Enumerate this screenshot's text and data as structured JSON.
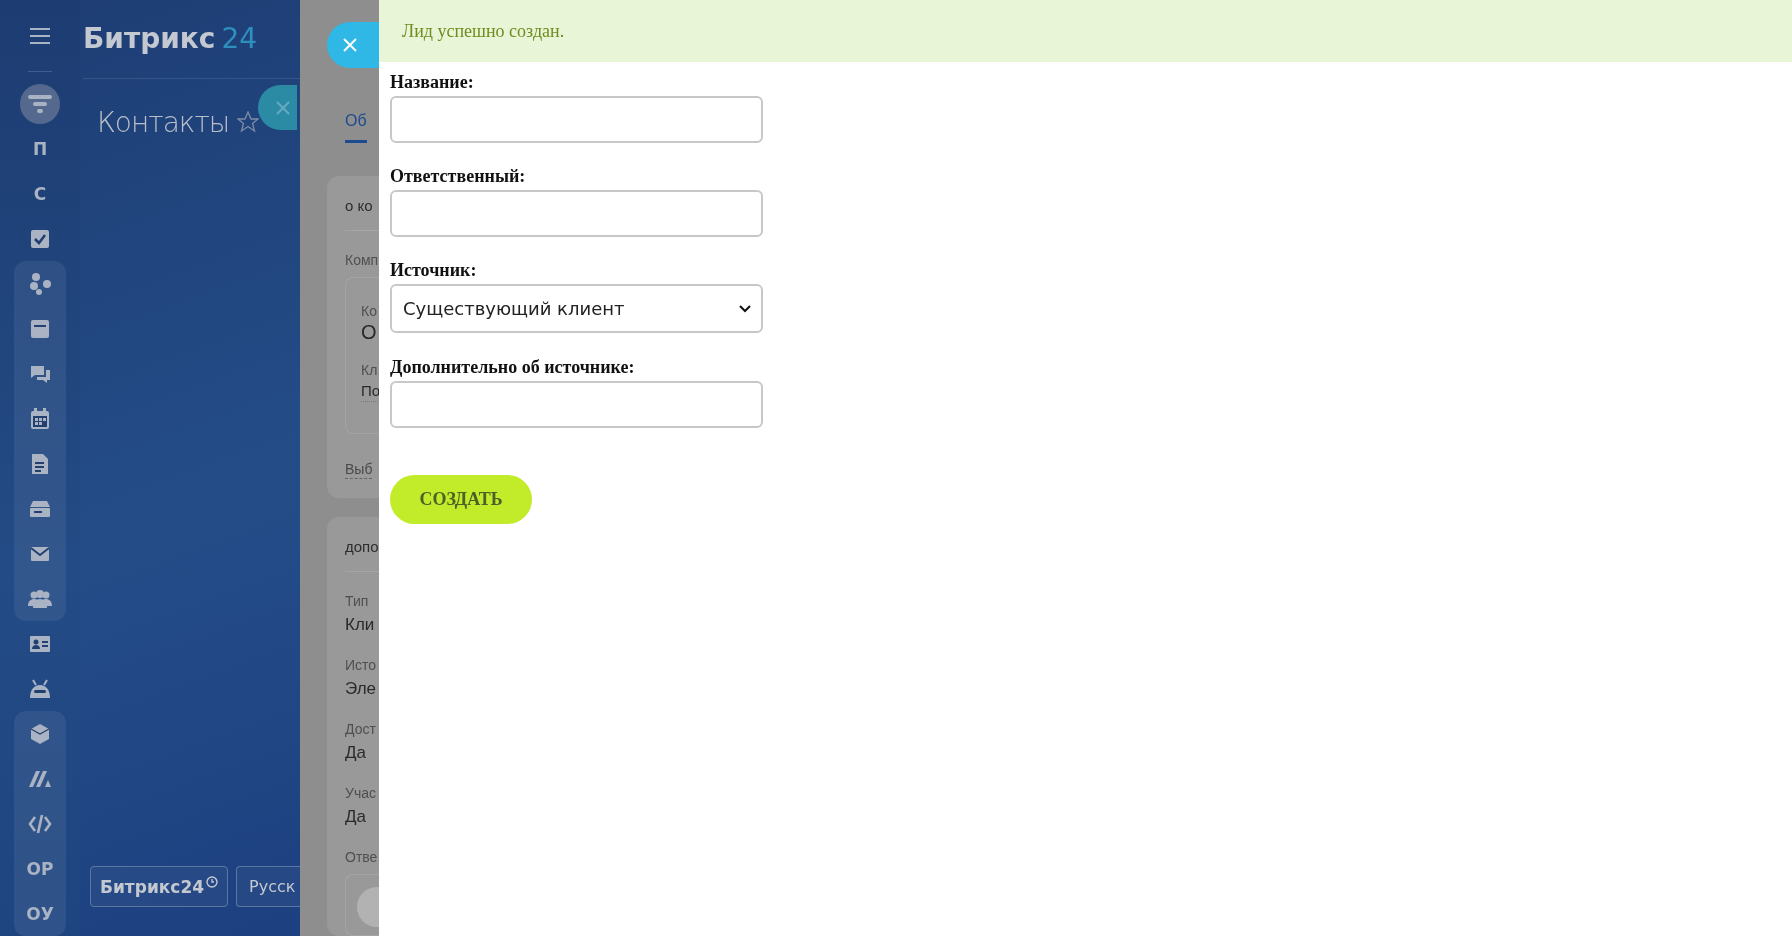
{
  "sidebar": {
    "groups": [
      {
        "framed": false,
        "items": [
          {
            "kind": "icon",
            "selected": true
          },
          {
            "kind": "letter",
            "label": "П",
            "selected": false
          },
          {
            "kind": "letter",
            "label": "С",
            "selected": false
          },
          {
            "kind": "icon",
            "selected": false
          }
        ]
      },
      {
        "framed": true,
        "items": [
          {
            "kind": "icon",
            "selected": false
          },
          {
            "kind": "icon",
            "selected": false
          },
          {
            "kind": "icon",
            "selected": false
          },
          {
            "kind": "icon",
            "selected": false
          },
          {
            "kind": "icon",
            "selected": false
          },
          {
            "kind": "icon",
            "selected": false
          },
          {
            "kind": "icon",
            "selected": false
          },
          {
            "kind": "icon",
            "selected": false
          }
        ]
      },
      {
        "framed": false,
        "items": [
          {
            "kind": "icon",
            "selected": false
          },
          {
            "kind": "icon",
            "selected": false
          }
        ]
      },
      {
        "framed": true,
        "items": [
          {
            "kind": "icon",
            "selected": false
          },
          {
            "kind": "icon",
            "selected": false
          },
          {
            "kind": "icon",
            "selected": false
          },
          {
            "kind": "letter",
            "label": "ОР",
            "selected": false
          },
          {
            "kind": "letter",
            "label": "ОУ",
            "selected": false
          }
        ]
      }
    ]
  },
  "header": {
    "logo_name": "Битрикс",
    "logo_number": "24"
  },
  "page_title": "Контакты",
  "footer_buttons": [
    {
      "label": "Битрикс24"
    },
    {
      "label": "Русск"
    }
  ],
  "detail_panel": {
    "tabs": [
      {
        "label": "Об",
        "selected": true
      }
    ],
    "cards": [
      {
        "title": "о ко",
        "fields": [
          {
            "label": "Комп"
          }
        ],
        "inner": [
          {
            "label": "Ко",
            "value": "О"
          },
          {
            "label": "Кл",
            "value": "По"
          }
        ],
        "link": "Выб"
      },
      {
        "title": "допо",
        "fields": [
          {
            "label": "Тип",
            "value": "Кли"
          },
          {
            "label": "Исто",
            "value": "Эле"
          },
          {
            "label": "Дост",
            "value": "Да"
          },
          {
            "label": "Учас",
            "value": "Да"
          },
          {
            "label": "Отве"
          }
        ],
        "avatar": true
      }
    ]
  },
  "lead_form": {
    "message": "Лид успешно создан.",
    "fields": [
      {
        "label": "Название:",
        "kind": "text"
      },
      {
        "label": "Ответственный:",
        "kind": "text"
      },
      {
        "label": "Источник:",
        "kind": "select",
        "value": "Существующий клиент"
      },
      {
        "label": "Дополнительно об источнике:",
        "kind": "text"
      }
    ],
    "submit": "СОЗДАТЬ"
  }
}
